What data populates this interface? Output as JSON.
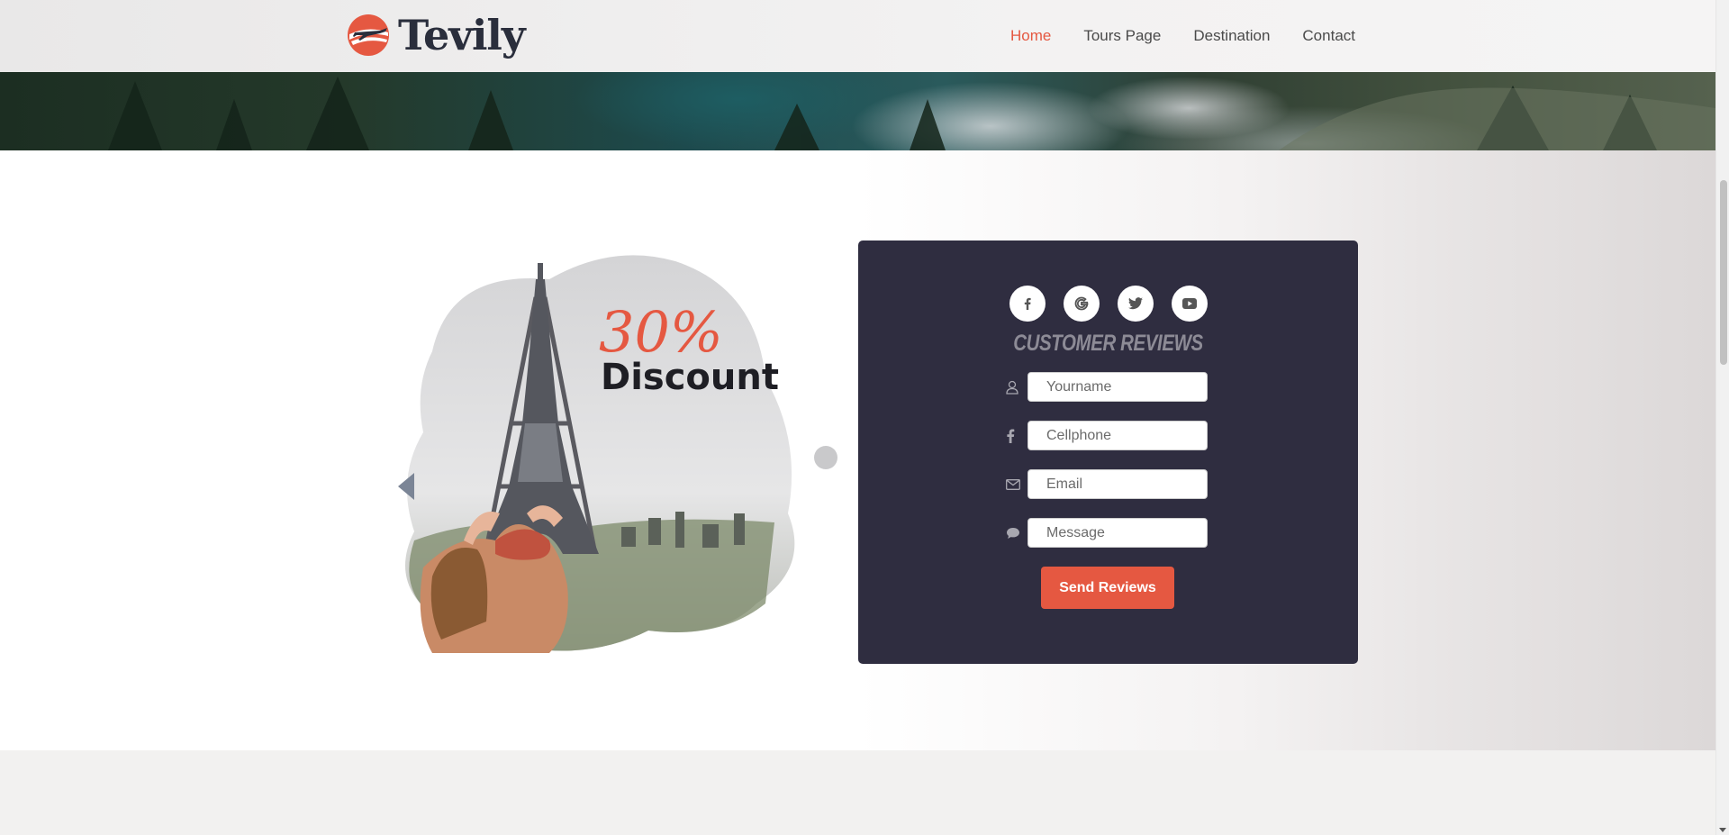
{
  "brand": {
    "name": "Tevily",
    "accent": "#e55841",
    "dark": "#2a2e3c"
  },
  "nav": {
    "items": [
      {
        "label": "Home",
        "active": true
      },
      {
        "label": "Tours Page",
        "active": false
      },
      {
        "label": "Destination",
        "active": false
      },
      {
        "label": "Contact",
        "active": false
      }
    ]
  },
  "promo": {
    "percent": "30%",
    "label": "Discount"
  },
  "reviews": {
    "title": "CUSTOMER REVIEWS",
    "socials": [
      "facebook-icon",
      "google-icon",
      "twitter-icon",
      "youtube-icon"
    ],
    "fields": {
      "name": {
        "placeholder": "Yourname",
        "icon": "user-icon"
      },
      "phone": {
        "placeholder": "Cellphone",
        "icon": "facebook-icon"
      },
      "email": {
        "placeholder": "Email",
        "icon": "envelope-icon"
      },
      "message": {
        "placeholder": "Message",
        "icon": "comment-icon"
      }
    },
    "submit_label": "Send Reviews",
    "card_color": "#2f2d40"
  }
}
